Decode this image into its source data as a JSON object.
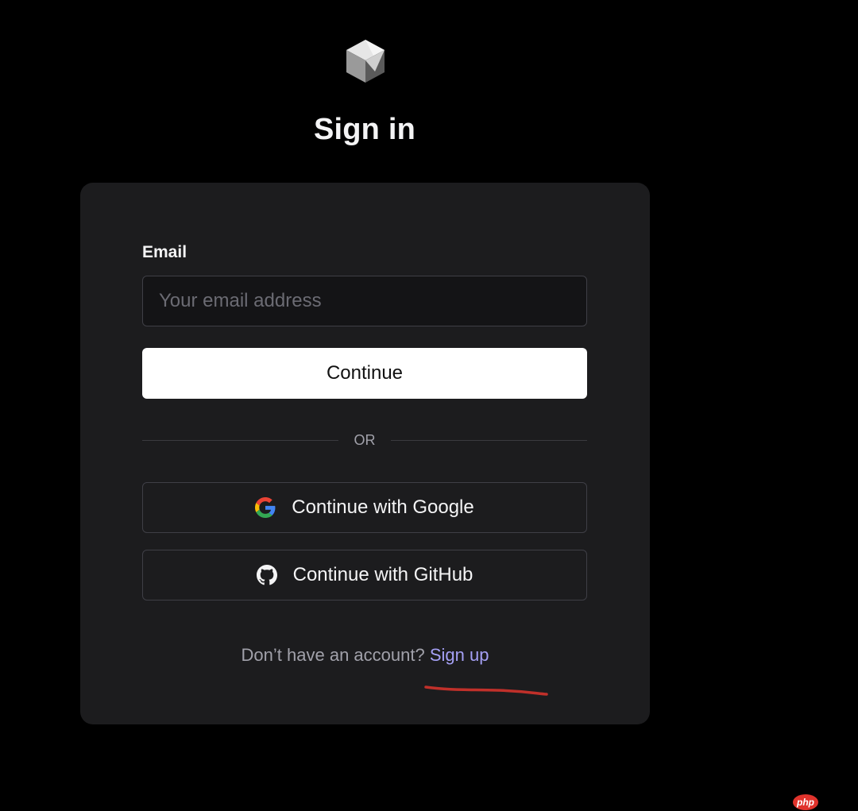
{
  "header": {
    "logo_icon": "cube-logo-icon",
    "title": "Sign in"
  },
  "form": {
    "email_label": "Email",
    "email_value": "",
    "email_placeholder": "Your email address",
    "continue_label": "Continue",
    "divider_text": "OR"
  },
  "oauth": {
    "google": {
      "label": "Continue with Google",
      "icon": "google-icon"
    },
    "github": {
      "label": "Continue with GitHub",
      "icon": "github-icon"
    }
  },
  "footer": {
    "prompt_text": "Don’t have an account? ",
    "signup_label": "Sign up"
  },
  "watermark": {
    "text": "php"
  },
  "colors": {
    "background": "#000000",
    "card": "#1c1c1e",
    "primary_button": "#ffffff",
    "link": "#a5a0f5",
    "annotation": "#c0302a"
  }
}
